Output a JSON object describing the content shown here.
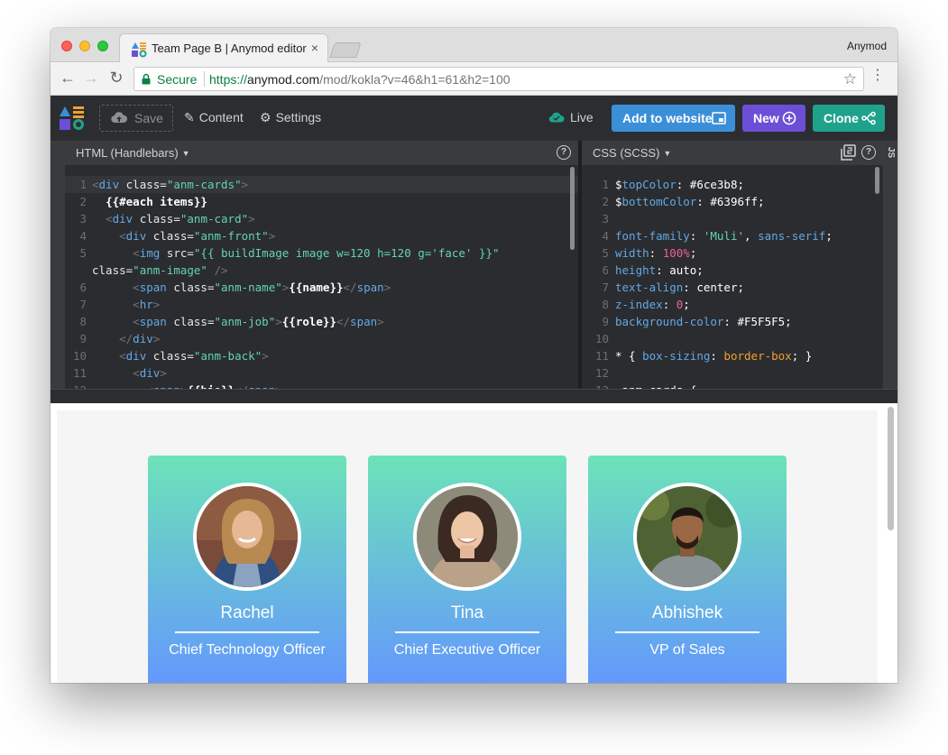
{
  "browser": {
    "tab_title": "Team Page B | Anymod editor",
    "tab_close": "×",
    "profile_name": "Anymod",
    "secure_label": "Secure",
    "url_proto": "https://",
    "url_host": "anymod.com",
    "url_path": "/mod/kokla?v=46&h1=61&h2=100",
    "star_icon": "☆",
    "menu_icon": "⋮"
  },
  "toolbar": {
    "save_label": "Save",
    "content_label": "Content",
    "settings_label": "Settings",
    "live_label": "Live",
    "add_label": "Add to website",
    "new_label": "New",
    "clone_label": "Clone"
  },
  "html_pane": {
    "title": "HTML (Handlebars)",
    "lines": [
      {
        "n": "1",
        "html": "<span class=\"p\">&lt;</span><span class=\"t\">div</span> <span class=\"a\">class</span>=<span class=\"s\">\"anm-cards\"</span><span class=\"p\">&gt;</span>",
        "hl": true
      },
      {
        "n": "2",
        "html": "  <span class=\"h\">{{#each items}}</span>"
      },
      {
        "n": "3",
        "html": "  <span class=\"p\">&lt;</span><span class=\"t\">div</span> <span class=\"a\">class</span>=<span class=\"s\">\"anm-card\"</span><span class=\"p\">&gt;</span>"
      },
      {
        "n": "4",
        "html": "    <span class=\"p\">&lt;</span><span class=\"t\">div</span> <span class=\"a\">class</span>=<span class=\"s\">\"anm-front\"</span><span class=\"p\">&gt;</span>"
      },
      {
        "n": "5",
        "html": "      <span class=\"p\">&lt;</span><span class=\"t\">img</span> <span class=\"a\">src</span>=<span class=\"s\">\"{{ buildImage image w=120 h=120 g='face' }}\"</span>"
      },
      {
        "n": "",
        "html": "<span class=\"a\">class</span>=<span class=\"s\">\"anm-image\"</span> <span class=\"p\">/&gt;</span>"
      },
      {
        "n": "6",
        "html": "      <span class=\"p\">&lt;</span><span class=\"t\">span</span> <span class=\"a\">class</span>=<span class=\"s\">\"anm-name\"</span><span class=\"p\">&gt;</span><span class=\"h\">{{name}}</span><span class=\"p\">&lt;/</span><span class=\"t\">span</span><span class=\"p\">&gt;</span>"
      },
      {
        "n": "7",
        "html": "      <span class=\"p\">&lt;</span><span class=\"t\">hr</span><span class=\"p\">&gt;</span>"
      },
      {
        "n": "8",
        "html": "      <span class=\"p\">&lt;</span><span class=\"t\">span</span> <span class=\"a\">class</span>=<span class=\"s\">\"anm-job\"</span><span class=\"p\">&gt;</span><span class=\"h\">{{role}}</span><span class=\"p\">&lt;/</span><span class=\"t\">span</span><span class=\"p\">&gt;</span>"
      },
      {
        "n": "9",
        "html": "    <span class=\"p\">&lt;/</span><span class=\"t\">div</span><span class=\"p\">&gt;</span>"
      },
      {
        "n": "10",
        "html": "    <span class=\"p\">&lt;</span><span class=\"t\">div</span> <span class=\"a\">class</span>=<span class=\"s\">\"anm-back\"</span><span class=\"p\">&gt;</span>"
      },
      {
        "n": "11",
        "html": "      <span class=\"p\">&lt;</span><span class=\"t\">div</span><span class=\"p\">&gt;</span>"
      },
      {
        "n": "12",
        "html": "        <span class=\"p\">&lt;</span><span class=\"t\">span</span><span class=\"p\">&gt;</span><span class=\"h\">{{bio}}</span><span class=\"p\">&lt;/</span><span class=\"t\">span</span><span class=\"p\">&gt;</span>"
      }
    ]
  },
  "css_pane": {
    "title": "CSS (SCSS)",
    "side_tab": "JS",
    "lines": [
      {
        "n": "1",
        "html": "<span class=\"w\">$</span><span class=\"v\">topColor</span><span class=\"w\">: #6ce3b8;</span>"
      },
      {
        "n": "2",
        "html": "<span class=\"w\">$</span><span class=\"v\">bottomColor</span><span class=\"w\">: #6396ff;</span>"
      },
      {
        "n": "3",
        "html": ""
      },
      {
        "n": "4",
        "html": "<span class=\"k\">font-family</span><span class=\"w\">: </span><span class=\"s\">'Muli'</span><span class=\"w\">, </span><span class=\"k\">sans-serif</span><span class=\"w\">;</span>"
      },
      {
        "n": "5",
        "html": "<span class=\"k\">width</span><span class=\"w\">: </span><span class=\"n\">100%</span><span class=\"w\">;</span>"
      },
      {
        "n": "6",
        "html": "<span class=\"k\">height</span><span class=\"w\">: auto;</span>"
      },
      {
        "n": "7",
        "html": "<span class=\"k\">text-align</span><span class=\"w\">: center;</span>"
      },
      {
        "n": "8",
        "html": "<span class=\"k\">z-index</span><span class=\"w\">: </span><span class=\"n\">0</span><span class=\"w\">;</span>"
      },
      {
        "n": "9",
        "html": "<span class=\"k\">background-color</span><span class=\"w\">: #F5F5F5;</span>"
      },
      {
        "n": "10",
        "html": ""
      },
      {
        "n": "11",
        "html": "<span class=\"w\">* { </span><span class=\"k\">box-sizing</span><span class=\"w\">: </span><span class=\"o\">border-box</span><span class=\"w\">; }</span>"
      },
      {
        "n": "12",
        "html": ""
      },
      {
        "n": "13",
        "html": "<span class=\"w\">.anm-cards {</span>"
      }
    ]
  },
  "preview": {
    "cards": [
      {
        "name": "Rachel",
        "job": "Chief Technology Officer"
      },
      {
        "name": "Tina",
        "job": "Chief Executive Officer"
      },
      {
        "name": "Abhishek",
        "job": "VP of Sales"
      }
    ]
  },
  "colors": {
    "topColor": "#6ce3b8",
    "bottomColor": "#6396ff",
    "add_button": "#3b8fd9",
    "new_button": "#6c4fd6",
    "clone_button": "#1fa28c"
  }
}
